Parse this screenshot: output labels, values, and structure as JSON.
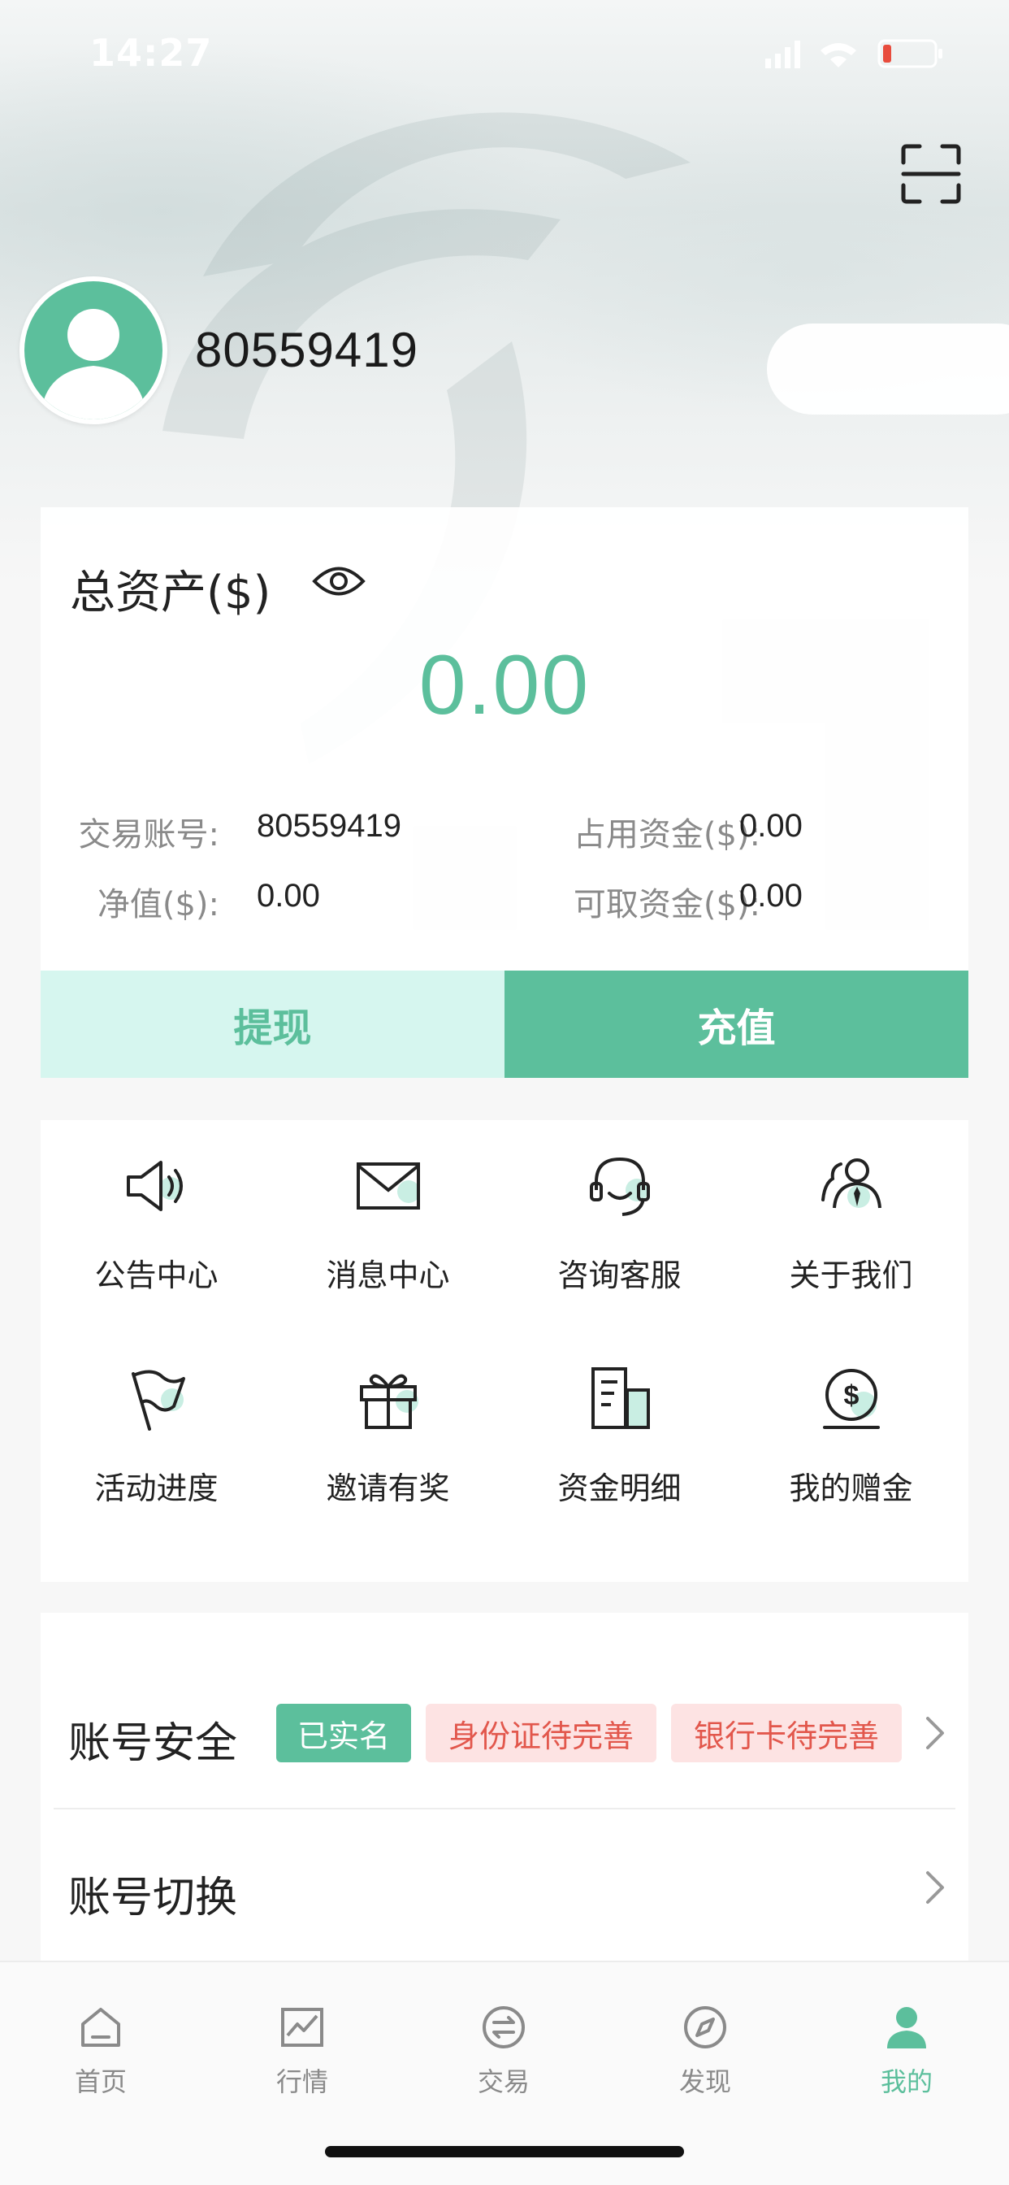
{
  "status_bar": {
    "time": "14:27"
  },
  "profile": {
    "username": "80559419"
  },
  "assets": {
    "title": "总资产($)",
    "total": "0.00",
    "trading_account_label": "交易账号:",
    "trading_account_value": "80559419",
    "occupied_funds_label": "占用资金($):",
    "occupied_funds_value": "0.00",
    "net_value_label": "净值($):",
    "net_value_value": "0.00",
    "withdrawable_label": "可取资金($):",
    "withdrawable_value": "0.00",
    "withdraw_button": "提现",
    "deposit_button": "充值"
  },
  "services": [
    {
      "label": "公告中心",
      "icon": "megaphone-icon"
    },
    {
      "label": "消息中心",
      "icon": "envelope-icon"
    },
    {
      "label": "咨询客服",
      "icon": "headset-icon"
    },
    {
      "label": "关于我们",
      "icon": "team-icon"
    },
    {
      "label": "活动进度",
      "icon": "flag-icon"
    },
    {
      "label": "邀请有奖",
      "icon": "gift-icon"
    },
    {
      "label": "资金明细",
      "icon": "document-icon"
    },
    {
      "label": "我的赠金",
      "icon": "dollar-coin-icon"
    }
  ],
  "account": {
    "security_title": "账号安全",
    "tag_verified": "已实名",
    "tag_id_pending": "身份证待完善",
    "tag_bank_pending": "银行卡待完善",
    "switch_title": "账号切换"
  },
  "tabbar": {
    "items": [
      {
        "label": "首页",
        "icon": "home-icon"
      },
      {
        "label": "行情",
        "icon": "chart-icon"
      },
      {
        "label": "交易",
        "icon": "exchange-icon"
      },
      {
        "label": "发现",
        "icon": "compass-icon"
      },
      {
        "label": "我的",
        "icon": "user-icon"
      }
    ],
    "active_index": 4
  },
  "colors": {
    "accent": "#5cbf9c",
    "accent_light": "#d6f6ef",
    "warning_bg": "#fde3e3",
    "warning_text": "#e2574c"
  }
}
